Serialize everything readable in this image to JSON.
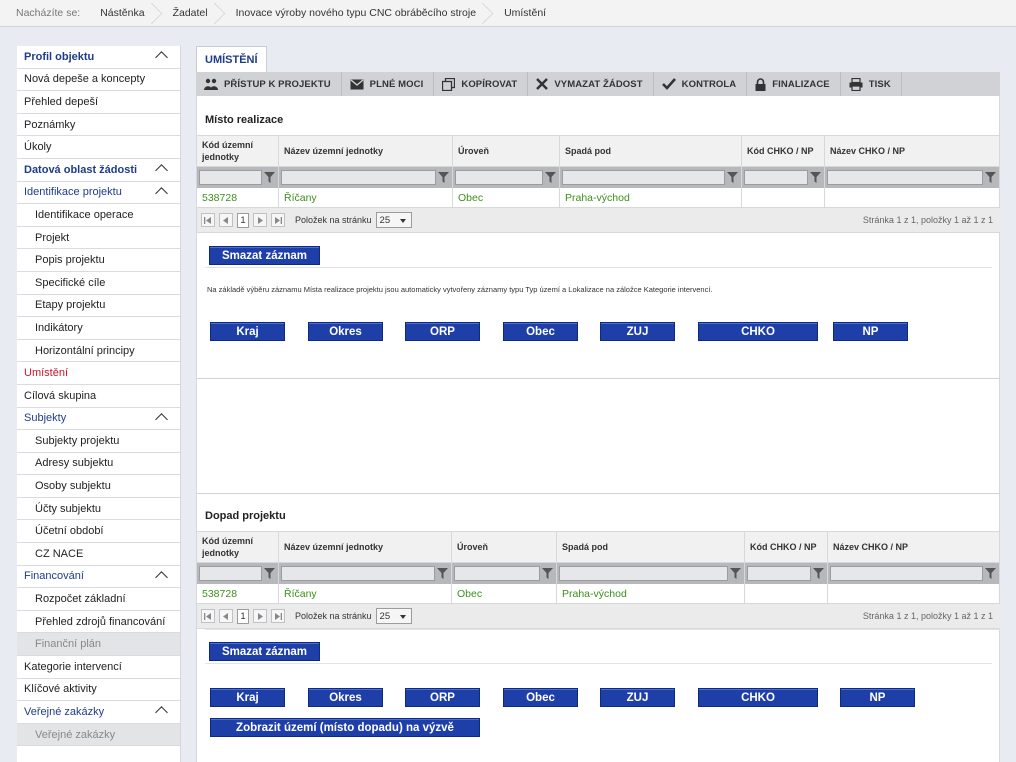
{
  "breadcrumb": {
    "prefix": "Nacházíte se:",
    "items": [
      "Nástěnka",
      "Žadatel",
      "Inovace výroby nového typu CNC obráběcího stroje",
      "Umístění"
    ]
  },
  "sidebar": {
    "items": [
      {
        "label": "Profil objektu",
        "kind": "section",
        "chevron": true
      },
      {
        "label": "Nová depeše a koncepty",
        "kind": "item"
      },
      {
        "label": "Přehled depeší",
        "kind": "item"
      },
      {
        "label": "Poznámky",
        "kind": "item"
      },
      {
        "label": "Úkoly",
        "kind": "item"
      },
      {
        "label": "Datová oblast žádosti",
        "kind": "section",
        "chevron": true
      },
      {
        "label": "Identifikace projektu",
        "kind": "section-light",
        "chevron": true
      },
      {
        "label": "Identifikace operace",
        "kind": "sub"
      },
      {
        "label": "Projekt",
        "kind": "sub"
      },
      {
        "label": "Popis projektu",
        "kind": "sub"
      },
      {
        "label": "Specifické cíle",
        "kind": "sub"
      },
      {
        "label": "Etapy projektu",
        "kind": "sub"
      },
      {
        "label": "Indikátory",
        "kind": "sub"
      },
      {
        "label": "Horizontální principy",
        "kind": "sub"
      },
      {
        "label": "Umístění",
        "kind": "active"
      },
      {
        "label": "Cílová skupina",
        "kind": "item"
      },
      {
        "label": "Subjekty",
        "kind": "section-light",
        "chevron": true
      },
      {
        "label": "Subjekty projektu",
        "kind": "sub"
      },
      {
        "label": "Adresy subjektu",
        "kind": "sub"
      },
      {
        "label": "Osoby subjektu",
        "kind": "sub"
      },
      {
        "label": "Účty subjektu",
        "kind": "sub"
      },
      {
        "label": "Účetní období",
        "kind": "sub"
      },
      {
        "label": "CZ NACE",
        "kind": "sub"
      },
      {
        "label": "Financování",
        "kind": "section-light",
        "chevron": true
      },
      {
        "label": "Rozpočet základní",
        "kind": "sub"
      },
      {
        "label": "Přehled zdrojů financování",
        "kind": "sub"
      },
      {
        "label": "Finanční plán",
        "kind": "sub-disabled"
      },
      {
        "label": "Kategorie intervencí",
        "kind": "item"
      },
      {
        "label": "Klíčové aktivity",
        "kind": "item"
      },
      {
        "label": "Veřejné zakázky",
        "kind": "section-light",
        "chevron": true
      },
      {
        "label": "Veřejné zakázky",
        "kind": "sub-disabled"
      }
    ]
  },
  "tab": {
    "label": "UMÍSTĚNÍ"
  },
  "toolbar": {
    "buttons": [
      {
        "label": "PŘÍSTUP K PROJEKTU",
        "icon": "users-icon"
      },
      {
        "label": "PLNÉ MOCI",
        "icon": "envelope-icon"
      },
      {
        "label": "KOPÍROVAT",
        "icon": "copy-icon"
      },
      {
        "label": "VYMAZAT ŽÁDOST",
        "icon": "x-icon"
      },
      {
        "label": "KONTROLA",
        "icon": "check-icon"
      },
      {
        "label": "FINALIZACE",
        "icon": "lock-icon"
      },
      {
        "label": "TISK",
        "icon": "printer-icon"
      }
    ]
  },
  "misto": {
    "title": "Místo realizace",
    "headers": [
      "Kód územní jednotky",
      "Název územní jednotky",
      "Úroveň",
      "Spadá pod",
      "Kód CHKO / NP",
      "Název CHKO / NP"
    ],
    "row": [
      "538728",
      "Říčany",
      "Obec",
      "Praha-východ",
      "",
      ""
    ],
    "pager": {
      "page": "1",
      "per_page_label": "Položek na stránku",
      "per_page": "25",
      "info": "Stránka 1 z 1, položky 1 až 1 z 1"
    },
    "delete_label": "Smazat záznam",
    "note": "Na základě výběru záznamu Místa realizace projektu jsou automaticky vytvořeny záznamy typu Typ území a Lokalizace na záložce Kategorie intervencí.",
    "buttons": [
      "Kraj",
      "Okres",
      "ORP",
      "Obec",
      "ZUJ",
      "CHKO",
      "NP"
    ]
  },
  "dopad": {
    "title": "Dopad projektu",
    "headers": [
      "Kód územní jednotky",
      "Název územní jednotky",
      "Úroveň",
      "Spadá pod",
      "Kód CHKO / NP",
      "Název CHKO / NP"
    ],
    "row": [
      "538728",
      "Říčany",
      "Obec",
      "Praha-východ",
      "",
      ""
    ],
    "pager": {
      "page": "1",
      "per_page_label": "Položek na stránku",
      "per_page": "25",
      "info": "Stránka 1 z 1, položky 1 až 1 z 1"
    },
    "delete_label": "Smazat záznam",
    "buttons": [
      "Kraj",
      "Okres",
      "ORP",
      "Obec",
      "ZUJ",
      "CHKO",
      "NP"
    ],
    "show_label": "Zobrazit území (místo dopadu) na výzvě"
  },
  "colors": {
    "accent": "#1f3c88",
    "button": "#1f3fa8",
    "active": "#c4172c",
    "row_text": "#3d8f1c"
  }
}
